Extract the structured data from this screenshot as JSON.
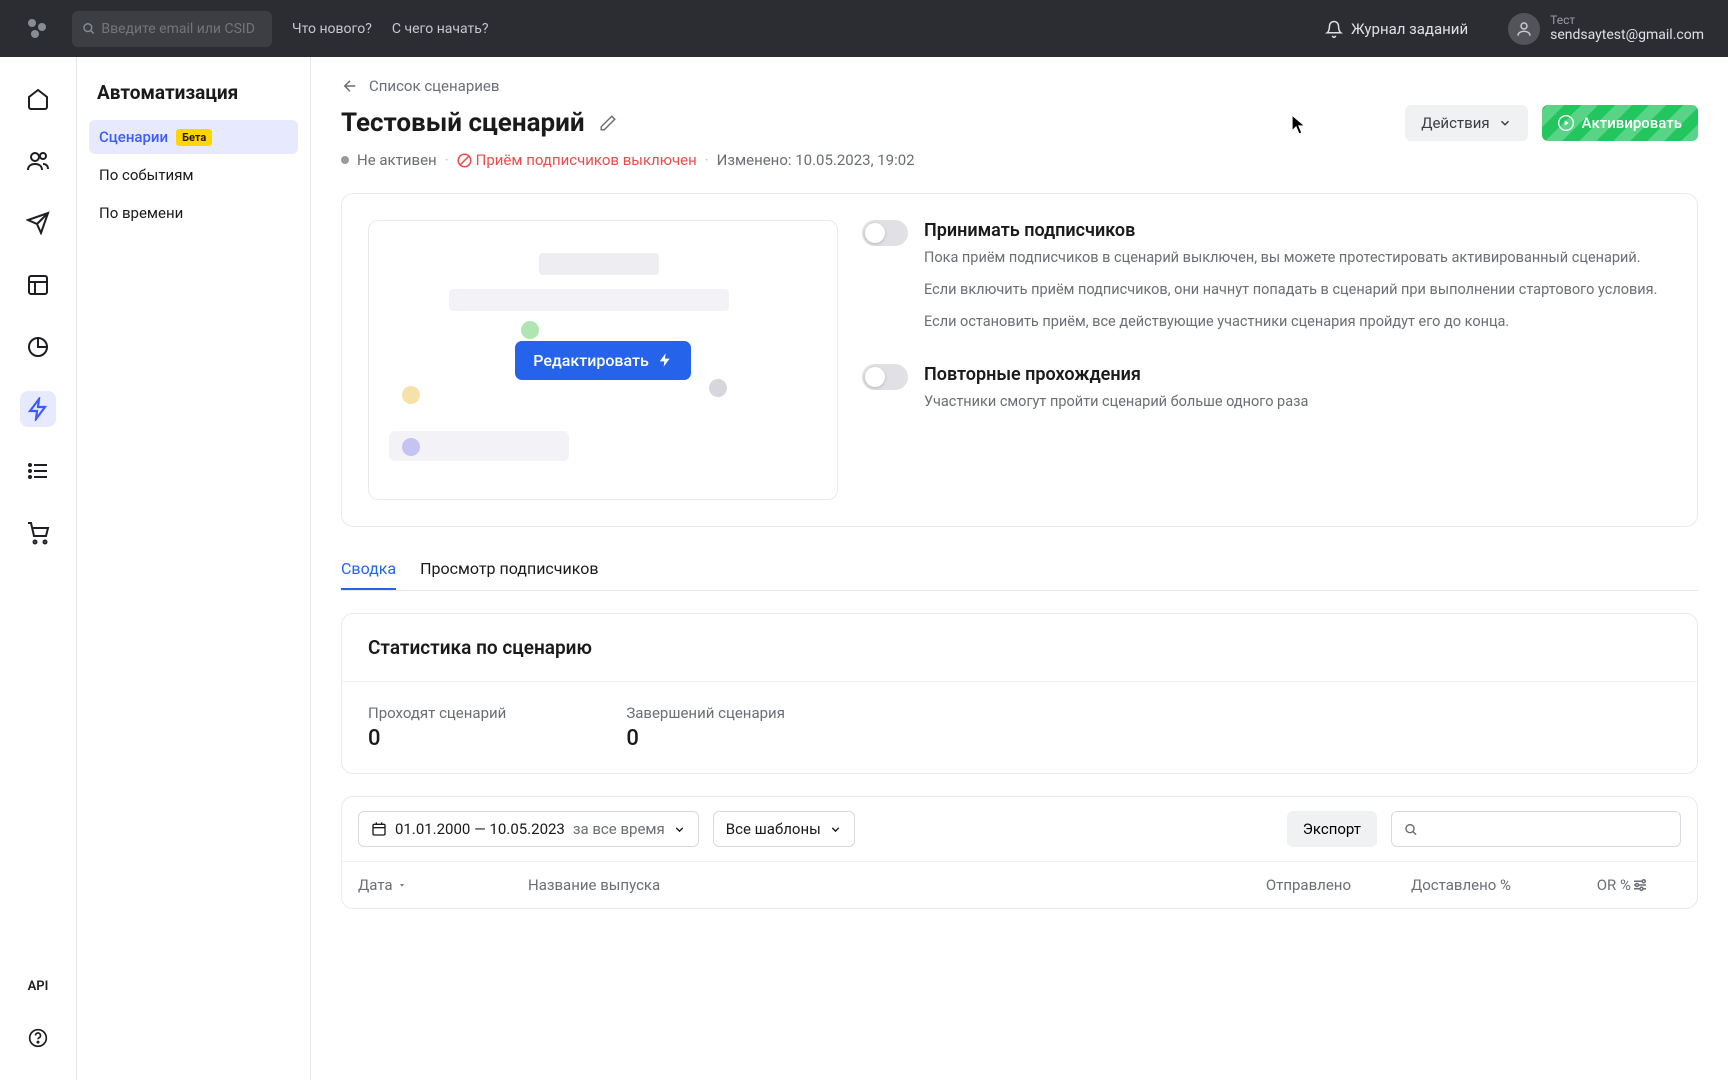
{
  "topbar": {
    "search_placeholder": "Введите email или CSID",
    "whats_new": "Что нового?",
    "getting_started": "С чего начать?",
    "journal": "Журнал заданий",
    "user_label": "Тест",
    "user_email": "sendsaytest@gmail.com"
  },
  "rail": {
    "api": "API"
  },
  "sidebar": {
    "title": "Автоматизация",
    "items": [
      {
        "label": "Сценарии",
        "badge": "Бета",
        "active": true
      },
      {
        "label": "По событиям"
      },
      {
        "label": "По времени"
      }
    ]
  },
  "breadcrumb": {
    "back": "Список сценариев"
  },
  "header": {
    "title": "Тестовый сценарий",
    "actions_btn": "Действия",
    "activate_btn": "Активировать"
  },
  "status": {
    "inactive": "Не активен",
    "intake_off": "Приём подписчиков выключен",
    "modified": "Изменено: 10.05.2023, 19:02"
  },
  "config": {
    "edit_btn": "Редактировать",
    "toggle1_title": "Принимать подписчиков",
    "toggle1_p1": "Пока приём подписчиков в сценарий выключен, вы можете протестировать активированный сценарий.",
    "toggle1_p2": "Если включить приём подписчиков, они начнут попадать в сценарий при выполнении стартового условия.",
    "toggle1_p3": "Если остановить приём, все действующие участники сценария пройдут его до конца.",
    "toggle2_title": "Повторные прохождения",
    "toggle2_p1": "Участники смогут пройти сценарий больше одного раза"
  },
  "tabs": {
    "summary": "Сводка",
    "subscribers": "Просмотр подписчиков"
  },
  "stats": {
    "title": "Статистика по сценарию",
    "in_progress_label": "Проходят сценарий",
    "in_progress_value": "0",
    "completed_label": "Завершений сценария",
    "completed_value": "0"
  },
  "table": {
    "date_range": "01.01.2000 — 10.05.2023",
    "date_preset": "за все время",
    "templates": "Все шаблоны",
    "export": "Экспорт",
    "col_date": "Дата",
    "col_name": "Название выпуска",
    "col_sent": "Отправлено",
    "col_delivered": "Доставлено %",
    "col_or": "OR %"
  }
}
